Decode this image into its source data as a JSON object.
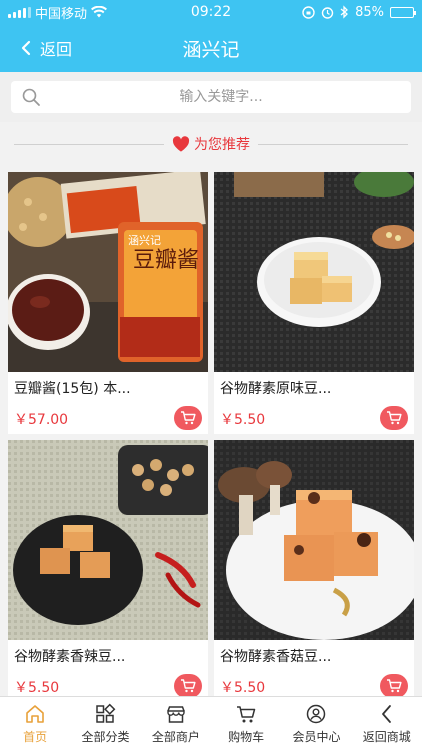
{
  "status_bar": {
    "carrier": "中国移动",
    "time": "09:22",
    "battery": "85%",
    "battery_level": 0.85
  },
  "nav": {
    "back_label": "返回",
    "title": "涵兴记"
  },
  "search": {
    "placeholder": "输入关键字..."
  },
  "section": {
    "title": "为您推荐"
  },
  "products": [
    {
      "name": "豆瓣酱(15包) 本...",
      "price": "￥57.00"
    },
    {
      "name": "谷物酵素原味豆...",
      "price": "￥5.50"
    },
    {
      "name": "谷物酵素香辣豆...",
      "price": "￥5.50"
    },
    {
      "name": "谷物酵素香菇豆...",
      "price": "￥5.50"
    }
  ],
  "product_thumbs": {
    "p1_pack_text": "豆瓣酱",
    "p1_brand": "涵兴记"
  },
  "tabs": [
    {
      "label": "首页",
      "icon": "home-icon"
    },
    {
      "label": "全部分类",
      "icon": "category-icon"
    },
    {
      "label": "全部商户",
      "icon": "store-icon"
    },
    {
      "label": "购物车",
      "icon": "cart-icon"
    },
    {
      "label": "会员中心",
      "icon": "user-icon"
    },
    {
      "label": "返回商城",
      "icon": "back-icon"
    }
  ],
  "colors": {
    "primary": "#3ec4f2",
    "accent_red": "#e8383d",
    "active_tab": "#e8a13a"
  }
}
